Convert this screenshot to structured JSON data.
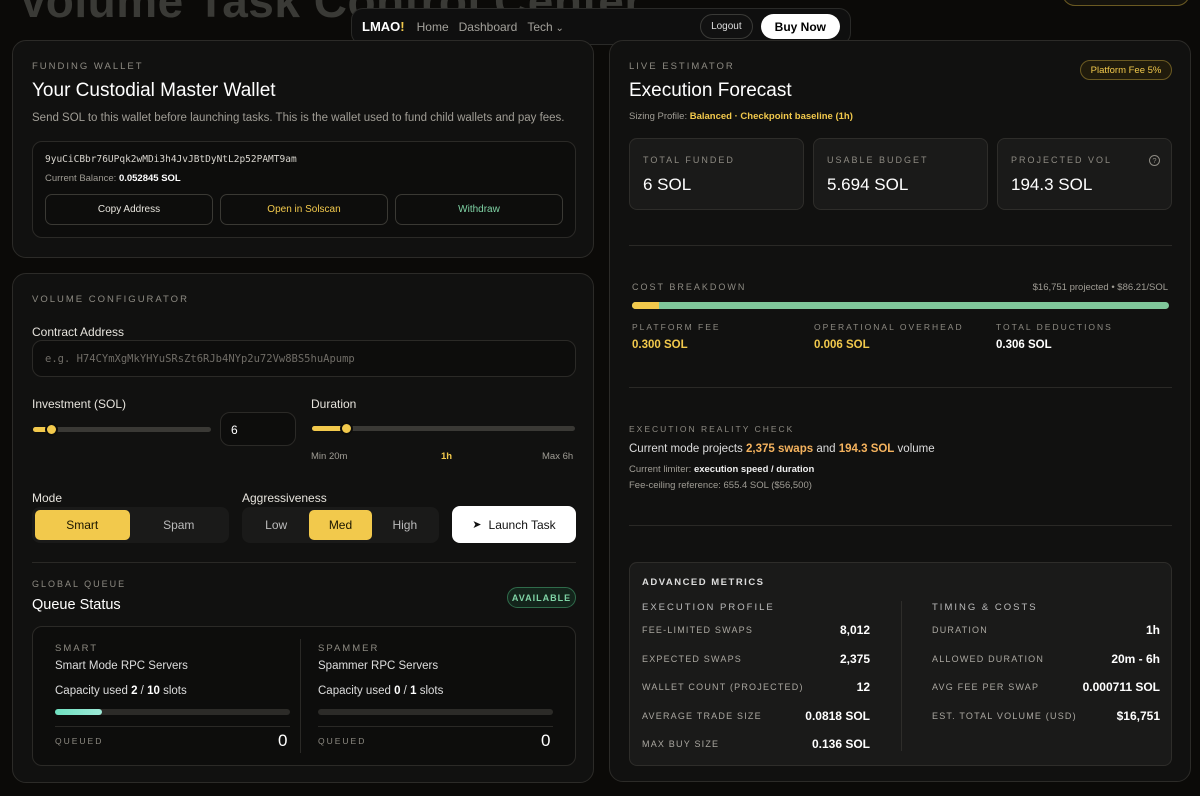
{
  "header": {
    "page_title": "Volume Task Control Center",
    "logo_text": "LMAO",
    "logo_mark": "!",
    "nav": [
      "Home",
      "Dashboard",
      "Tech"
    ],
    "logout": "Logout",
    "buy": "Buy Now"
  },
  "wallet": {
    "eyebrow": "FUNDING WALLET",
    "title": "Your Custodial Master Wallet",
    "description": "Send SOL to this wallet before launching tasks. This is the wallet used to fund child wallets and pay fees.",
    "address": "9yuCiCBbr76UPqk2wMDi3h4JvJBtDyNtL2p52PAMT9am",
    "balance_label": "Current Balance:",
    "balance": "0.052845 SOL",
    "copy": "Copy Address",
    "solscan": "Open in Solscan",
    "withdraw": "Withdraw"
  },
  "config": {
    "eyebrow": "VOLUME CONFIGURATOR",
    "contract_label": "Contract Address",
    "contract_placeholder": "e.g. H74CYmXgMkYHYuSRsZt6RJb4NYp2u72Vw8BS5huApump",
    "investment_label": "Investment (SOL)",
    "investment_value": "6",
    "investment_slider": 0.1,
    "duration_label": "Duration",
    "duration_slider": 0.13,
    "duration_min": "Min 20m",
    "duration_current": "1h",
    "duration_max": "Max 6h",
    "mode_label": "Mode",
    "modes": [
      "Smart",
      "Spam"
    ],
    "aggr_label": "Aggressiveness",
    "aggr": [
      "Low",
      "Med",
      "High"
    ],
    "launch": "Launch Task"
  },
  "queue": {
    "eyebrow": "GLOBAL QUEUE",
    "title": "Queue Status",
    "badge": "AVAILABLE",
    "smart": {
      "eyebrow": "SMART",
      "title": "Smart Mode RPC Servers",
      "cap_label": "Capacity used",
      "used": "2",
      "total": "10",
      "unit": "slots",
      "queued_label": "QUEUED",
      "queued": "0",
      "fill": 0.2
    },
    "spam": {
      "eyebrow": "SPAMMER",
      "title": "Spammer RPC Servers",
      "cap_label": "Capacity used",
      "used": "0",
      "total": "1",
      "unit": "slots",
      "queued_label": "QUEUED",
      "queued": "0",
      "fill": 0
    }
  },
  "forecast": {
    "eyebrow": "LIVE ESTIMATOR",
    "title": "Execution Forecast",
    "fee_badge": "Platform Fee 5%",
    "sizing_label": "Sizing Profile:",
    "sizing_value": "Balanced · Checkpoint baseline (1h)",
    "metrics": [
      {
        "label": "TOTAL FUNDED",
        "value": "6 SOL"
      },
      {
        "label": "USABLE BUDGET",
        "value": "5.694 SOL"
      },
      {
        "label": "PROJECTED VOL",
        "value": "194.3 SOL"
      }
    ],
    "cost_eyebrow": "COST BREAKDOWN",
    "cost_note": "$16,751 projected • $86.21/SOL",
    "cost_fee_fraction": 0.05,
    "costs": [
      {
        "label": "PLATFORM FEE",
        "value": "0.300 SOL"
      },
      {
        "label": "OPERATIONAL OVERHEAD",
        "value": "0.006 SOL"
      },
      {
        "label": "TOTAL DEDUCTIONS",
        "value": "0.306 SOL"
      }
    ],
    "reality_eyebrow": "EXECUTION REALITY CHECK",
    "reality_prefix": "Current mode projects",
    "reality_swaps": "2,375 swaps",
    "reality_and": "and",
    "reality_vol": "194.3 SOL",
    "reality_suffix": "volume",
    "limiter_label": "Current limiter:",
    "limiter_value": "execution speed / duration",
    "ceiling": "Fee-ceiling reference: 655.4 SOL ($56,500)"
  },
  "advanced": {
    "title": "ADVANCED METRICS",
    "profile_title": "EXECUTION PROFILE",
    "profile": [
      {
        "label": "FEE-LIMITED SWAPS",
        "value": "8,012"
      },
      {
        "label": "EXPECTED SWAPS",
        "value": "2,375"
      },
      {
        "label": "WALLET COUNT (PROJECTED)",
        "value": "12"
      },
      {
        "label": "AVERAGE TRADE SIZE",
        "value": "0.0818 SOL"
      },
      {
        "label": "MAX BUY SIZE",
        "value": "0.136 SOL"
      }
    ],
    "timing_title": "TIMING & COSTS",
    "timing": [
      {
        "label": "DURATION",
        "value": "1h"
      },
      {
        "label": "ALLOWED DURATION",
        "value": "20m - 6h"
      },
      {
        "label": "AVG FEE PER SWAP",
        "value": "0.000711 SOL"
      },
      {
        "label": "EST. TOTAL VOLUME (USD)",
        "value": "$16,751"
      }
    ]
  },
  "colors": {
    "accent": "#f2c94c",
    "success": "#7fd3a5",
    "background": "#0b0a08"
  }
}
